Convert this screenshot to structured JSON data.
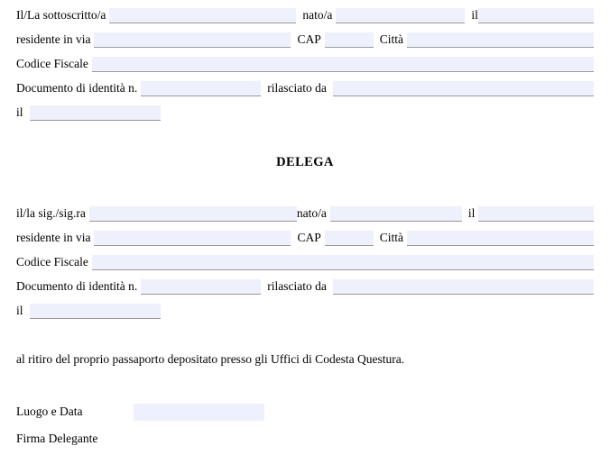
{
  "document": {
    "heading": "DELEGA",
    "paragraph": "al ritiro del proprio passaporto depositato presso gli Uffici di Codesta Questura.",
    "background_color": "#ffffff",
    "field_fill_color": "#eef0fb",
    "field_rule_color": "#9a9a9a",
    "text_color": "#000000"
  },
  "delegator_block": {
    "line1": {
      "label_1": "Il/La sottoscritto/a",
      "label_2": "nato/a",
      "label_3": "il"
    },
    "line2": {
      "label_1": "residente in via",
      "label_2": "CAP",
      "label_3": "Città"
    },
    "line3": {
      "label_1": "Codice Fiscale"
    },
    "line4": {
      "label_1": "Documento di identità n.",
      "label_2": "rilasciato da"
    },
    "line5": {
      "label_1": "il"
    }
  },
  "delegate_block": {
    "line1": {
      "label_1": "il/la sig./sig.ra",
      "label_2": "nato/a",
      "label_3": "il"
    },
    "line2": {
      "label_1": "residente in via",
      "label_2": "CAP",
      "label_3": "Città"
    },
    "line3": {
      "label_1": "Codice Fiscale"
    },
    "line4": {
      "label_1": "Documento di identità n.",
      "label_2": "rilasciato da"
    },
    "line5": {
      "label_1": "il"
    }
  },
  "signature": {
    "place_date_label": "Luogo e Data",
    "place_date_value": "",
    "signature_label": "Firma Delegante"
  },
  "field_values": {
    "d_nome": "",
    "d_nato": "",
    "d_il": "",
    "d_via": "",
    "d_cap": "",
    "d_citta": "",
    "d_cf": "",
    "d_doc": "",
    "d_rilasciato": "",
    "d_doc_il": "",
    "g_nome": "",
    "g_nato": "",
    "g_il": "",
    "g_via": "",
    "g_cap": "",
    "g_citta": "",
    "g_cf": "",
    "g_doc": "",
    "g_rilasciato": "",
    "g_doc_il": ""
  }
}
